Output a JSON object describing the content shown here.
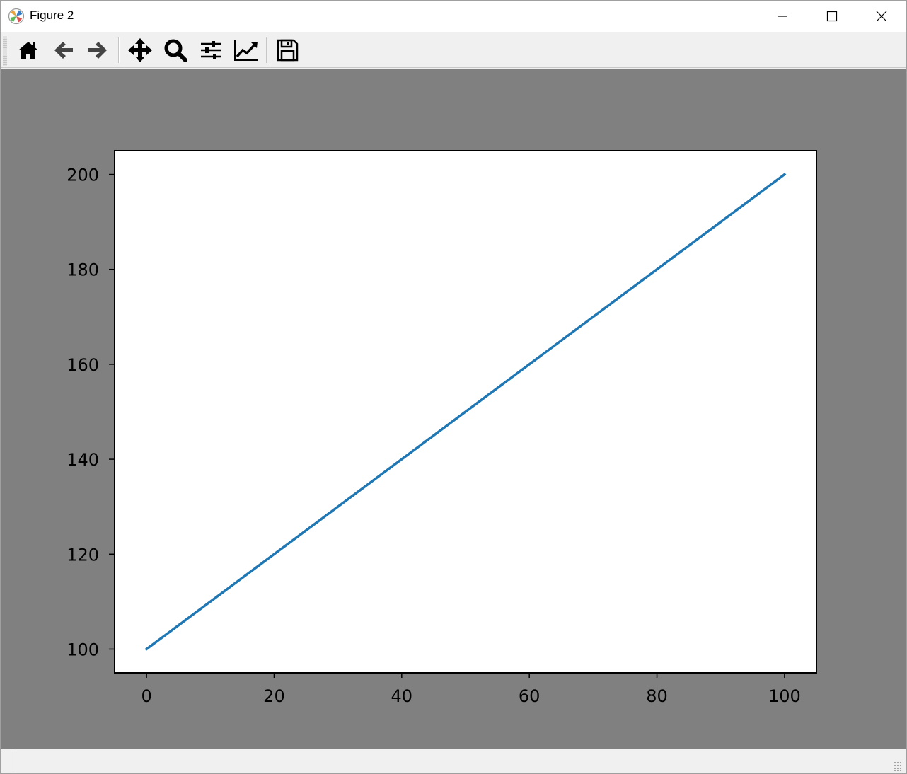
{
  "window": {
    "title": "Figure 2",
    "icons": {
      "app": "matplotlib-logo-icon",
      "minimize": "minimize-icon",
      "maximize": "maximize-icon",
      "close": "close-icon"
    }
  },
  "toolbar": {
    "tools": [
      {
        "id": "home",
        "icon": "home-icon"
      },
      {
        "id": "back",
        "icon": "arrow-left-icon"
      },
      {
        "id": "forward",
        "icon": "arrow-right-icon"
      },
      {
        "id": "pan",
        "icon": "move-icon"
      },
      {
        "id": "zoom",
        "icon": "magnifier-icon"
      },
      {
        "id": "subplots",
        "icon": "sliders-icon"
      },
      {
        "id": "edit-axes",
        "icon": "line-chart-icon"
      },
      {
        "id": "save",
        "icon": "floppy-disk-icon"
      }
    ]
  },
  "colors": {
    "canvas_bg": "#808080",
    "axes_bg": "#ffffff",
    "line": "#1f77b4",
    "spine": "#000000"
  },
  "chart_data": {
    "type": "line",
    "x": [
      0,
      100
    ],
    "series": [
      {
        "values": [
          100,
          200
        ],
        "color": "#1f77b4"
      }
    ],
    "title": "",
    "xlabel": "",
    "ylabel": "",
    "xlim": [
      -5,
      105
    ],
    "ylim": [
      95,
      205
    ],
    "xticks": [
      0,
      20,
      40,
      60,
      80,
      100
    ],
    "yticks": [
      100,
      120,
      140,
      160,
      180,
      200
    ],
    "xtick_labels": [
      "0",
      "20",
      "40",
      "60",
      "80",
      "100"
    ],
    "ytick_labels": [
      "100",
      "120",
      "140",
      "160",
      "180",
      "200"
    ],
    "grid": false,
    "legend": "none"
  }
}
